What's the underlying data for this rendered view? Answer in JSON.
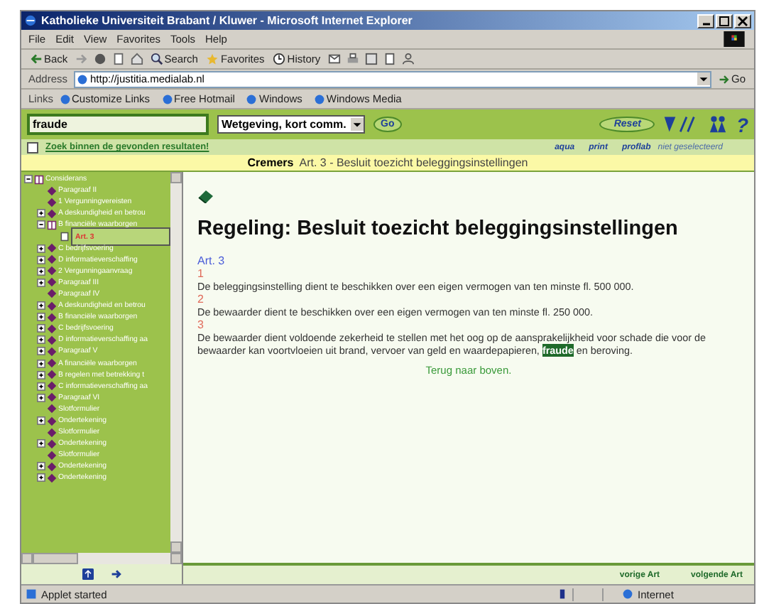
{
  "window": {
    "title": "Katholieke Universiteit Brabant / Kluwer - Microsoft Internet Explorer"
  },
  "menu": [
    "File",
    "Edit",
    "View",
    "Favorites",
    "Tools",
    "Help"
  ],
  "toolbar": [
    {
      "kind": "back",
      "label": "Back"
    },
    {
      "kind": "search",
      "label": "Search"
    },
    {
      "kind": "favorites",
      "label": "Favorites"
    },
    {
      "kind": "history",
      "label": "History"
    }
  ],
  "address": {
    "label": "Address",
    "value": "http://justitia.medialab.nl",
    "go": "Go"
  },
  "links": {
    "label": "Links",
    "items": [
      "Customize Links",
      "Free Hotmail",
      "Windows",
      "Windows Media"
    ]
  },
  "search": {
    "value": "fraude",
    "scope": "Wetgeving, kort comm.",
    "go": "Go",
    "reset": "Reset",
    "help": "?"
  },
  "filter": {
    "checked": false,
    "label": "Zoek binnen de gevonden resultaten!",
    "links": [
      "aqua",
      "print",
      "proflab"
    ],
    "status": "niet geselecteerd"
  },
  "breadcrumb": {
    "author": "Cremers",
    "title": "Art. 3 - Besluit toezicht beleggingsinstellingen"
  },
  "tree": [
    {
      "label": "Considerans",
      "kind": "open",
      "selected": false,
      "children": [
        {
          "label": "Paragraaf II",
          "kind": "leaf",
          "selected": false
        },
        {
          "label": "1 Vergunningvereisten",
          "kind": "leaf",
          "selected": false
        },
        {
          "label": "A deskundigheid en betrou",
          "kind": "closed",
          "selected": false
        },
        {
          "label": "B financiële waarborgen",
          "kind": "open",
          "selected": false,
          "children": [
            {
              "label": "Art. 3",
              "kind": "article",
              "selected": true
            }
          ]
        },
        {
          "label": "C bedrijfsvoering",
          "kind": "closed",
          "selected": false
        },
        {
          "label": "D informatieverschaffing",
          "kind": "closed",
          "selected": false
        },
        {
          "label": "2 Vergunningaanvraag",
          "kind": "closed",
          "selected": false
        },
        {
          "label": "Paragraaf III",
          "kind": "closed",
          "selected": false
        },
        {
          "label": "Paragraaf IV",
          "kind": "leaf",
          "selected": false
        },
        {
          "label": "A deskundigheid en betrou",
          "kind": "closed",
          "selected": false
        },
        {
          "label": "B financiële waarborgen",
          "kind": "closed",
          "selected": false
        },
        {
          "label": "C bedrijfsvoering",
          "kind": "closed",
          "selected": false
        },
        {
          "label": "D informatieverschaffing aa",
          "kind": "closed",
          "selected": false
        },
        {
          "label": "Paragraaf V",
          "kind": "closed",
          "selected": false
        },
        {
          "label": "A financiële waarborgen",
          "kind": "closed",
          "selected": false
        },
        {
          "label": "B regelen met betrekking t",
          "kind": "closed",
          "selected": false
        },
        {
          "label": "C informatieverschaffing aa",
          "kind": "closed",
          "selected": false
        },
        {
          "label": "Paragraaf VI",
          "kind": "closed",
          "selected": false
        },
        {
          "label": "Slotformulier",
          "kind": "leaf",
          "selected": false
        },
        {
          "label": "Ondertekening",
          "kind": "closed",
          "selected": false
        },
        {
          "label": "Slotformulier",
          "kind": "leaf",
          "selected": false
        },
        {
          "label": "Ondertekening",
          "kind": "closed",
          "selected": false
        },
        {
          "label": "Slotformulier",
          "kind": "leaf",
          "selected": false
        },
        {
          "label": "Ondertekening",
          "kind": "closed",
          "selected": false
        },
        {
          "label": "Ondertekening",
          "kind": "closed",
          "selected": false
        }
      ]
    }
  ],
  "document": {
    "heading": "Regeling: Besluit toezicht beleggingsinstellingen",
    "article": "Art. 3",
    "paragraphs": [
      {
        "number": "1",
        "before": "De beleggingsinstelling dient te beschikken over een eigen vermogen van ten minste fl. 500 000."
      },
      {
        "number": "2",
        "before": "De bewaarder dient te beschikken over een eigen vermogen van ten minste fl. 250 000."
      },
      {
        "number": "3",
        "before": "De bewaarder dient voldoende zekerheid te stellen met het oog op de aansprakelijkheid voor schade die voor de bewaarder kan voortvloeien uit brand, vervoer van geld en waardepapieren, ",
        "highlight": "fraude",
        "after": " en beroving."
      }
    ],
    "back_to_top": "Terug naar boven."
  },
  "nav": {
    "previous": "vorige Art",
    "next": "volgende Art"
  },
  "status_bar": {
    "text": "Applet started",
    "zone": "Internet"
  }
}
